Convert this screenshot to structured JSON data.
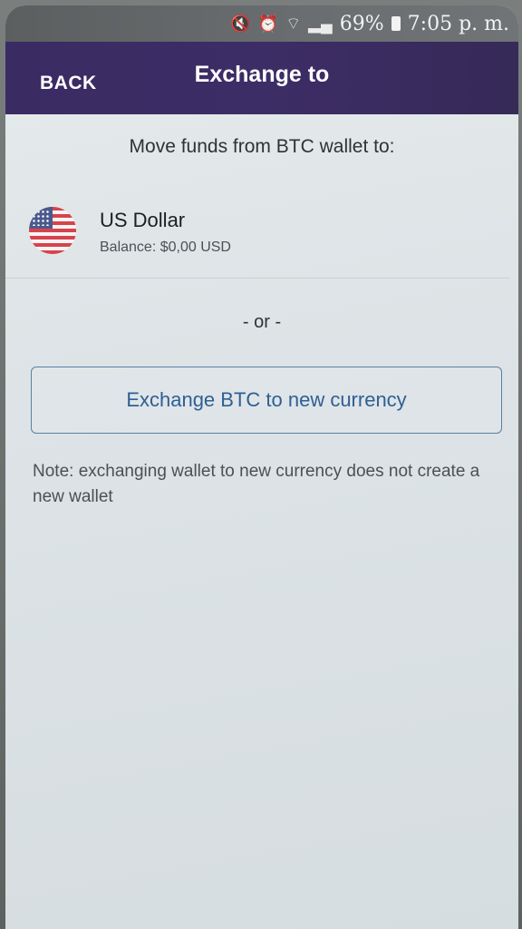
{
  "status_bar": {
    "icons": [
      "mute-icon",
      "alarm-icon",
      "wifi-icon",
      "signal-icon"
    ],
    "battery_percent": "69%",
    "time": "7:05 p. m."
  },
  "header": {
    "back_label": "BACK",
    "title": "Exchange to"
  },
  "main": {
    "prompt": "Move funds from BTC wallet to:",
    "currency": {
      "name": "US Dollar",
      "balance": "Balance: $0,00 USD",
      "flag_icon": "us-flag-icon"
    },
    "or_separator": "- or -",
    "exchange_button_label": "Exchange BTC to new currency",
    "note": "Note: exchanging wallet to new currency does not create a new wallet"
  },
  "colors": {
    "header_bg": "#3a2b63",
    "button_text": "#2f5f93",
    "button_border": "#5b7fa6"
  }
}
